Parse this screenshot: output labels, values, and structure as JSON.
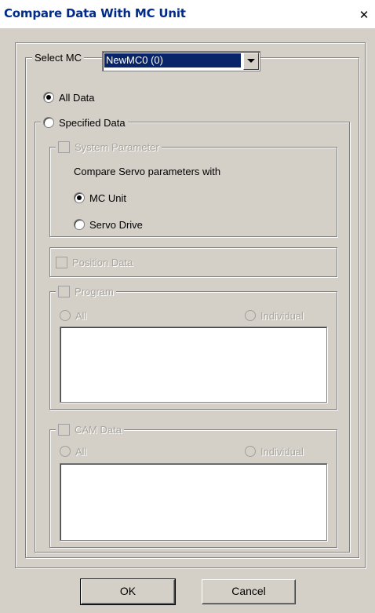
{
  "window": {
    "title": "Compare Data With MC Unit",
    "close_icon": "close-icon"
  },
  "select_mc": {
    "label": "Select MC",
    "value": "NewMC0 (0)"
  },
  "scope": {
    "all_data": "All Data",
    "specified_data": "Specified Data",
    "selected": "All Data"
  },
  "system_parameter": {
    "label": "System Parameter",
    "compare_text": "Compare Servo parameters with",
    "mc_unit": "MC Unit",
    "servo_drive": "Servo Drive",
    "selected": "MC Unit"
  },
  "position_data": {
    "label": "Position Data"
  },
  "program": {
    "label": "Program",
    "all": "All",
    "individual": "Individual"
  },
  "cam_data": {
    "label": "CAM Data",
    "all": "All",
    "individual": "Individual"
  },
  "buttons": {
    "ok": "OK",
    "cancel": "Cancel"
  }
}
